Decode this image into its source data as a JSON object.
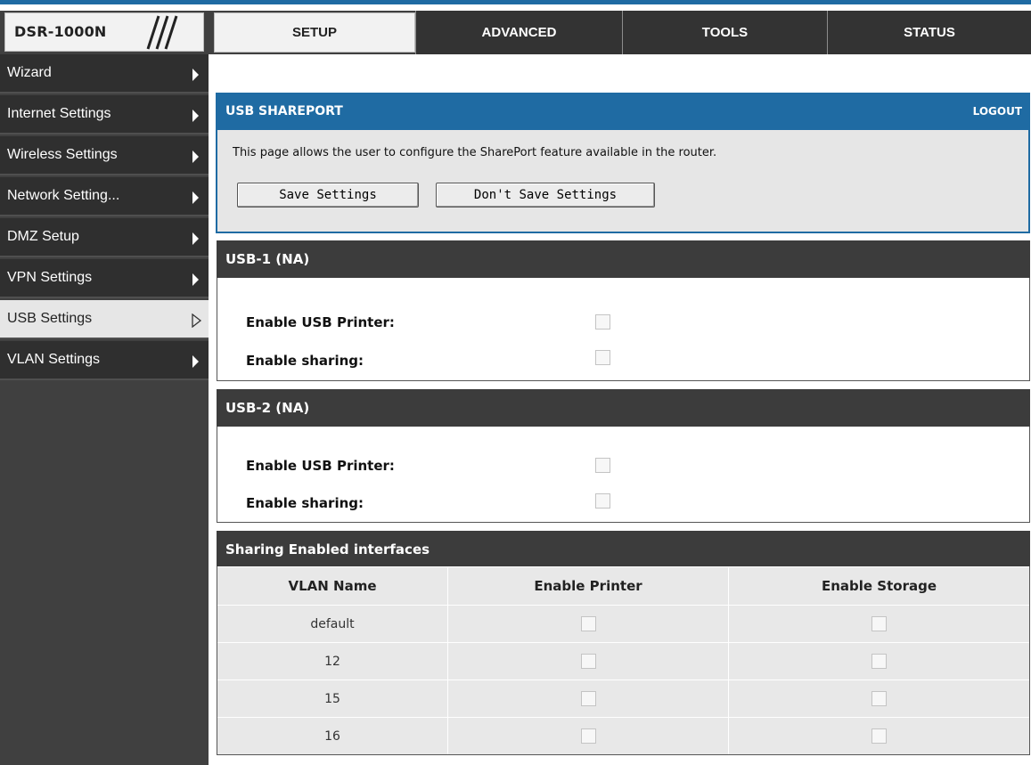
{
  "header": {
    "model": "DSR-1000N",
    "tabs": [
      {
        "label": "SETUP",
        "active": true
      },
      {
        "label": "ADVANCED",
        "active": false
      },
      {
        "label": "TOOLS",
        "active": false
      },
      {
        "label": "STATUS",
        "active": false
      }
    ]
  },
  "sidebar": {
    "items": [
      {
        "label": "Wizard",
        "active": false
      },
      {
        "label": "Internet Settings",
        "active": false
      },
      {
        "label": "Wireless Settings",
        "active": false
      },
      {
        "label": "Network Setting...",
        "active": false
      },
      {
        "label": "DMZ Setup",
        "active": false
      },
      {
        "label": "VPN Settings",
        "active": false
      },
      {
        "label": "USB Settings",
        "active": true
      },
      {
        "label": "VLAN Settings",
        "active": false
      }
    ]
  },
  "page": {
    "title": "USB SHAREPORT",
    "logout": "LOGOUT",
    "description": "This page allows the user to configure the SharePort feature available in the router.",
    "save_button": "Save Settings",
    "dont_save_button": "Don't Save Settings"
  },
  "usb1": {
    "title": "USB-1 (NA)",
    "printer_label": "Enable USB Printer:",
    "sharing_label": "Enable sharing:",
    "printer_checked": false,
    "sharing_checked": false
  },
  "usb2": {
    "title": "USB-2 (NA)",
    "printer_label": "Enable USB Printer:",
    "sharing_label": "Enable sharing:",
    "printer_checked": false,
    "sharing_checked": false
  },
  "sharing_table": {
    "title": "Sharing Enabled interfaces",
    "columns": [
      "VLAN Name",
      "Enable Printer",
      "Enable Storage"
    ],
    "rows": [
      {
        "vlan": "default",
        "printer": false,
        "storage": false
      },
      {
        "vlan": "12",
        "printer": false,
        "storage": false
      },
      {
        "vlan": "15",
        "printer": false,
        "storage": false
      },
      {
        "vlan": "16",
        "printer": false,
        "storage": false
      }
    ]
  },
  "colors": {
    "accent_blue": "#1f6ba3",
    "header_dark": "#404040",
    "sidebar_item": "#2f2f2f"
  }
}
